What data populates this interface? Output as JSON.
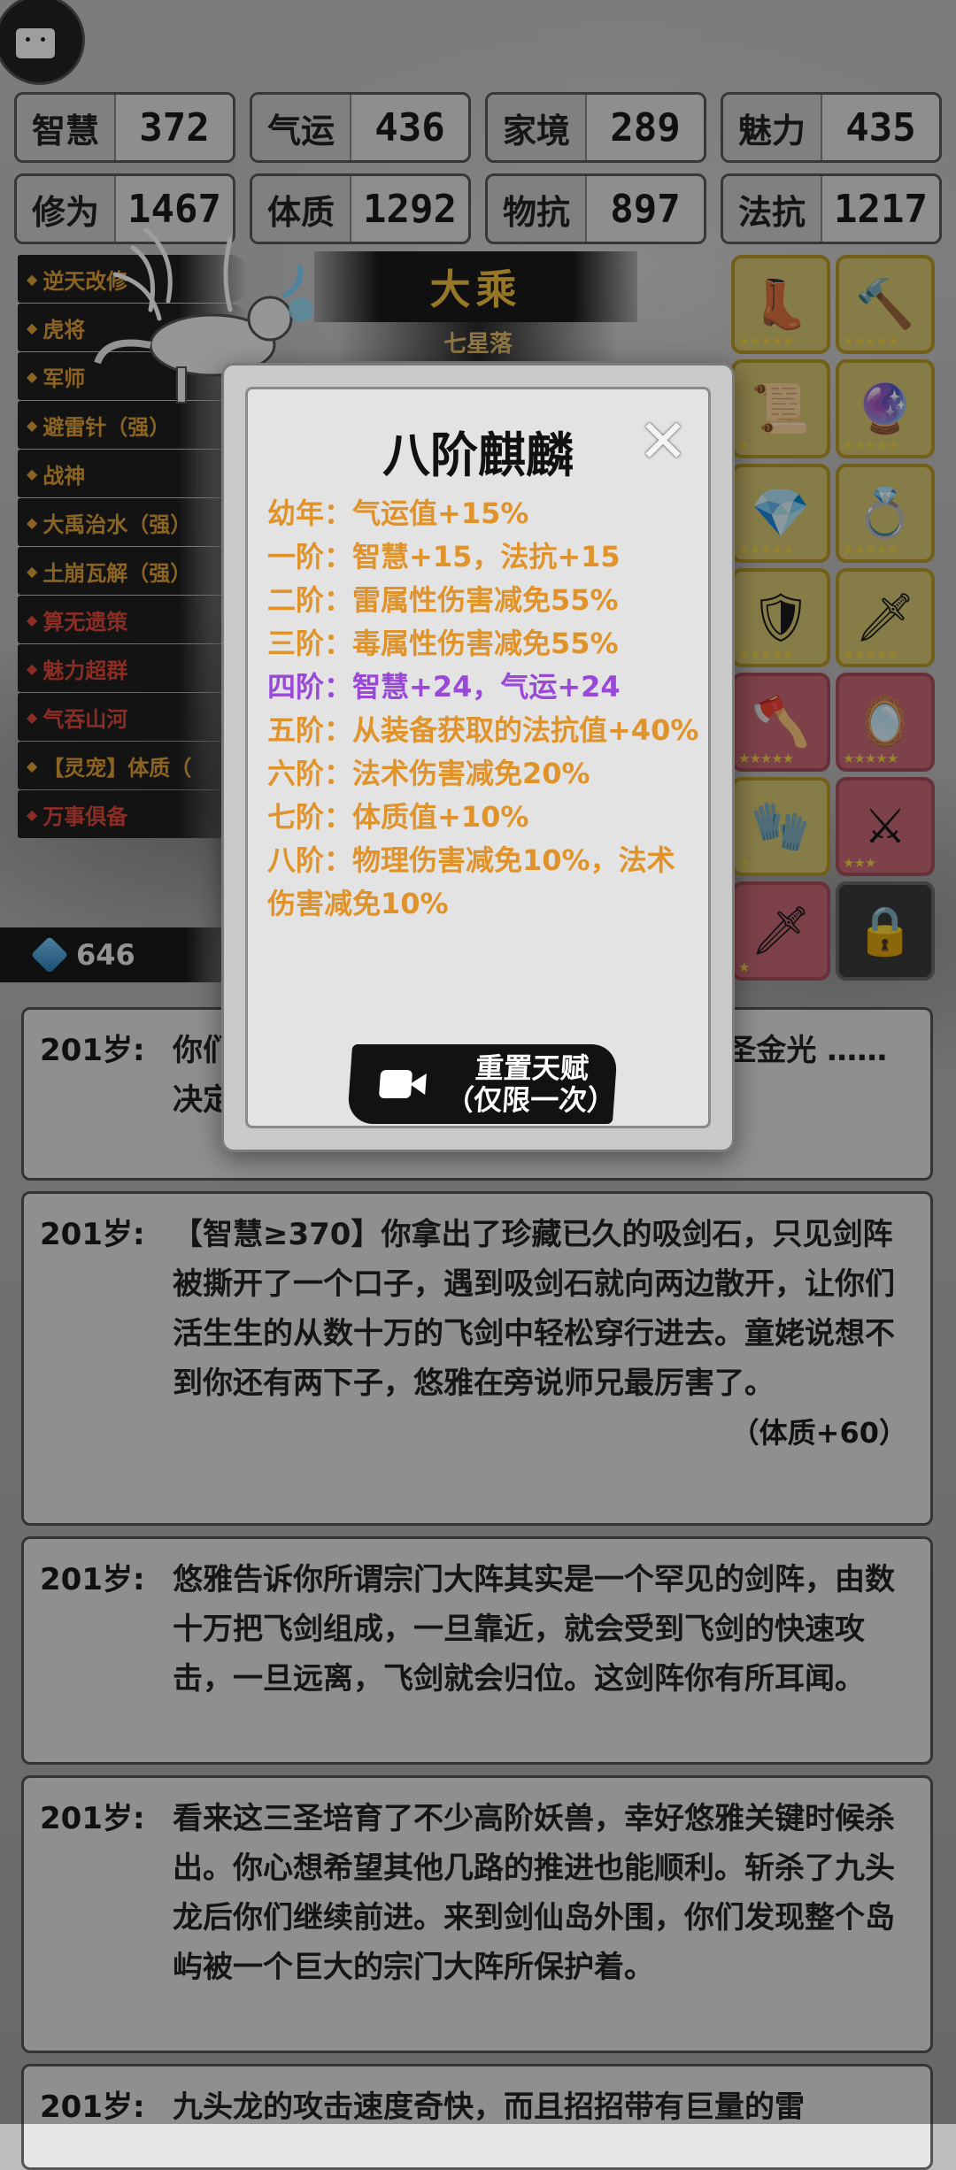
{
  "stats": [
    {
      "label": "智慧",
      "value": "372"
    },
    {
      "label": "气运",
      "value": "436"
    },
    {
      "label": "家境",
      "value": "289"
    },
    {
      "label": "魅力",
      "value": "435"
    },
    {
      "label": "修为",
      "value": "1467"
    },
    {
      "label": "体质",
      "value": "1292"
    },
    {
      "label": "物抗",
      "value": "897"
    },
    {
      "label": "法抗",
      "value": "1217"
    }
  ],
  "talents": [
    {
      "name": "逆天改修",
      "color": "orange"
    },
    {
      "name": "虎将",
      "color": "orange"
    },
    {
      "name": "军师",
      "color": "orange"
    },
    {
      "name": "避雷针（强）",
      "color": "orange"
    },
    {
      "name": "战神",
      "color": "orange"
    },
    {
      "name": "大禹治水（强）",
      "color": "orange"
    },
    {
      "name": "土崩瓦解（强）",
      "color": "orange"
    },
    {
      "name": "算无遗策",
      "color": "red"
    },
    {
      "name": "魅力超群",
      "color": "red"
    },
    {
      "name": "气吞山河",
      "color": "red"
    },
    {
      "name": "【灵宠】体质（",
      "color": "orange"
    },
    {
      "name": "万事俱备",
      "color": "red"
    }
  ],
  "realm": {
    "title": "大乘",
    "subtitle": "七星落"
  },
  "equipment": [
    {
      "icon": "boots-icon",
      "glyph": "👢",
      "stars": "★★★★★",
      "style": "gold"
    },
    {
      "icon": "hammer-icon",
      "glyph": "🔨",
      "stars": "★★★★★",
      "style": "gold"
    },
    {
      "icon": "scroll-icon",
      "glyph": "📜",
      "stars": "★",
      "style": "gold"
    },
    {
      "icon": "orb-icon",
      "glyph": "🔮",
      "stars": "★★★★★",
      "style": "gold"
    },
    {
      "icon": "crystal-icon",
      "glyph": "💎",
      "stars": "★★★★★",
      "style": "gold"
    },
    {
      "icon": "ring-icon",
      "glyph": "💍",
      "stars": "★★★★★",
      "style": "gold"
    },
    {
      "icon": "armor-icon",
      "glyph": "🛡",
      "stars": "★★★★★",
      "style": "gold"
    },
    {
      "icon": "blade-icon",
      "glyph": "🗡",
      "stars": "★★★★★",
      "style": "gold"
    },
    {
      "icon": "axe-icon",
      "glyph": "🪓",
      "stars": "★★★★★",
      "style": "pink"
    },
    {
      "icon": "mirror-icon",
      "glyph": "🪞",
      "stars": "★★★★★",
      "style": "pink"
    },
    {
      "icon": "gauntlet-icon",
      "glyph": "🧤",
      "stars": "★",
      "style": "gold"
    },
    {
      "icon": "spear-icon",
      "glyph": "⚔",
      "stars": "★★★",
      "style": "pink"
    },
    {
      "icon": "sword-icon",
      "glyph": "🗡",
      "stars": "★",
      "style": "pink"
    },
    {
      "icon": "lock-icon",
      "glyph": "🔒",
      "stars": "",
      "style": "locked"
    }
  ],
  "currency": {
    "icon": "spirit-stone-icon",
    "value": "646"
  },
  "modal": {
    "title": "八阶麒麟",
    "close_label": "✕",
    "lines": [
      {
        "text": "幼年：气运值+15%",
        "color": "orange"
      },
      {
        "text": "一阶：智慧+15，法抗+15",
        "color": "orange"
      },
      {
        "text": "二阶：雷属性伤害减免55%",
        "color": "orange"
      },
      {
        "text": "三阶：毒属性伤害减免55%",
        "color": "orange"
      },
      {
        "text": "四阶：智慧+24，气运+24",
        "color": "purple"
      },
      {
        "text": "五阶：从装备获取的法抗值+40%",
        "color": "orange"
      },
      {
        "text": "六阶：法术伤害减免20%",
        "color": "orange"
      },
      {
        "text": "七阶：体质值+10%",
        "color": "orange"
      },
      {
        "text": "八阶：物理伤害减免10%，法术伤害减免10%",
        "color": "orange"
      }
    ],
    "reset_line1": "重置天赋",
    "reset_line2": "（仅限一次）"
  },
  "logs": [
    {
      "age": "201岁:",
      "text": "你们 …… 们就服下了早已 …… 告诉你剑圣金光 …… 决定",
      "note": ""
    },
    {
      "age": "201岁:",
      "text": "【智慧≥370】你拿出了珍藏已久的吸剑石，只见剑阵被撕开了一个口子，遇到吸剑石就向两边散开，让你们活生生的从数十万的飞剑中轻松穿行进去。童姥说想不到你还有两下子，悠雅在旁说师兄最厉害了。",
      "note": "（体质+60）"
    },
    {
      "age": "201岁:",
      "text": "悠雅告诉你所谓宗门大阵其实是一个罕见的剑阵，由数十万把飞剑组成，一旦靠近，就会受到飞剑的快速攻击，一旦远离，飞剑就会归位。这剑阵你有所耳闻。",
      "note": ""
    },
    {
      "age": "201岁:",
      "text": "看来这三圣培育了不少高阶妖兽，幸好悠雅关键时候杀出。你心想希望其他几路的推进也能顺利。斩杀了九头龙后你们继续前进。来到剑仙岛外围，你们发现整个岛屿被一个巨大的宗门大阵所保护着。",
      "note": ""
    },
    {
      "age": "201岁:",
      "text": "九头龙的攻击速度奇快，而且招招带有巨量的雷",
      "note": ""
    }
  ],
  "colors": {
    "talent_orange": "#e0a23a",
    "talent_red": "#e04a3a",
    "modal_orange": "#e0932a",
    "modal_purple": "#9a48d8",
    "realm_gold": "#f0c040"
  }
}
